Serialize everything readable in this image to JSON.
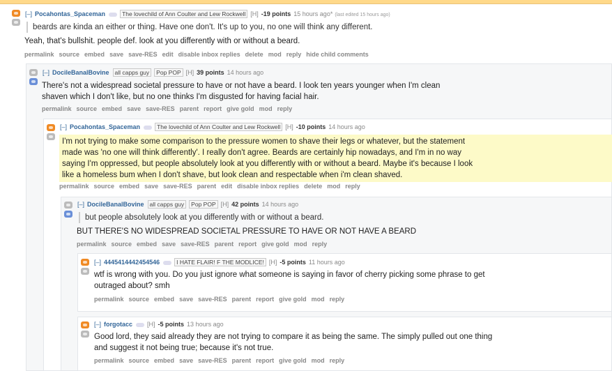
{
  "comments": [
    {
      "author": "Pocahontas_Spaceman",
      "flair": "The lovechild of Ann Coulter and Lew Rockwell",
      "history": "[H]",
      "score": "-19 points",
      "time": "15 hours ago*",
      "edited": "(last edited 15 hours ago)",
      "quote": "beards are kinda an either or thing. Have one don't. It's up to you, no one will think any different.",
      "text": "Yeah, that's bullshit. people def. look at you differently with or without a beard.",
      "buttons": [
        "permalink",
        "source",
        "embed",
        "save",
        "save-RES",
        "edit",
        "disable inbox replies",
        "delete",
        "mod",
        "reply",
        "hide child comments"
      ]
    },
    {
      "author": "DocileBanalBovine",
      "flair": "all capps guy",
      "flair2": "Pop POP",
      "history": "[H]",
      "score": "39 points",
      "time": "14 hours ago",
      "text_line1": "There's not a widespread societal pressure to have or not have a beard. I look ten years younger when I'm clean",
      "text_line2": "shaven which I don't like, but no one thinks I'm disgusted for having facial hair.",
      "buttons": [
        "permalink",
        "source",
        "embed",
        "save",
        "save-RES",
        "parent",
        "report",
        "give gold",
        "mod",
        "reply"
      ]
    },
    {
      "author": "Pocahontas_Spaceman",
      "flair": "The lovechild of Ann Coulter and Lew Rockwell",
      "history": "[H]",
      "score": "-10 points",
      "time": "14 hours ago",
      "text_line1": "I'm not trying to make some comparison to the pressure women to shave their legs or whatever, but the statement",
      "text_line2": "made was 'no one will think differently'. I really don't agree. Beards are certainly hip nowadays, and I'm in no way",
      "text_line3": "saying I'm oppressed, but people absolutely look at you differently with or without a beard. Maybe it's because I look",
      "text_line4": "like a homeless bum when I don't shave, but look clean and respectable when i'm clean shaved.",
      "buttons": [
        "permalink",
        "source",
        "embed",
        "save",
        "save-RES",
        "parent",
        "edit",
        "disable inbox replies",
        "delete",
        "mod",
        "reply"
      ]
    },
    {
      "author": "DocileBanalBovine",
      "flair": "all capps guy",
      "flair2": "Pop POP",
      "history": "[H]",
      "score": "42 points",
      "time": "14 hours ago",
      "quote": "but people absolutely look at you differently with or without a beard.",
      "text": "BUT THERE'S NO WIDESPREAD SOCIETAL PRESSURE TO HAVE OR NOT HAVE A BEARD",
      "buttons": [
        "permalink",
        "source",
        "embed",
        "save",
        "save-RES",
        "parent",
        "report",
        "give gold",
        "mod",
        "reply"
      ]
    },
    {
      "author": "4445414442454546",
      "flair": "I HATE FLAIR! F THE MODLICE!",
      "history": "[H]",
      "score": "-5 points",
      "time": "11 hours ago",
      "text_line1": "wtf is wrong with you. Do you just ignore what someone is saying in favor of cherry picking some phrase to get",
      "text_line2": "outraged about? smh",
      "buttons": [
        "permalink",
        "source",
        "embed",
        "save",
        "save-RES",
        "parent",
        "report",
        "give gold",
        "mod",
        "reply"
      ]
    },
    {
      "author": "forgotacc",
      "history": "[H]",
      "score": "-5 points",
      "time": "13 hours ago",
      "text_line1": "Good lord, they said already they are not trying to compare it as being the same. The simply pulled out one thing",
      "text_line2": "and suggest it not being true; because it's not true.",
      "buttons": [
        "permalink",
        "source",
        "embed",
        "save",
        "save-RES",
        "parent",
        "report",
        "give gold",
        "mod",
        "reply"
      ]
    }
  ],
  "ui": {
    "expand": "[–]"
  }
}
